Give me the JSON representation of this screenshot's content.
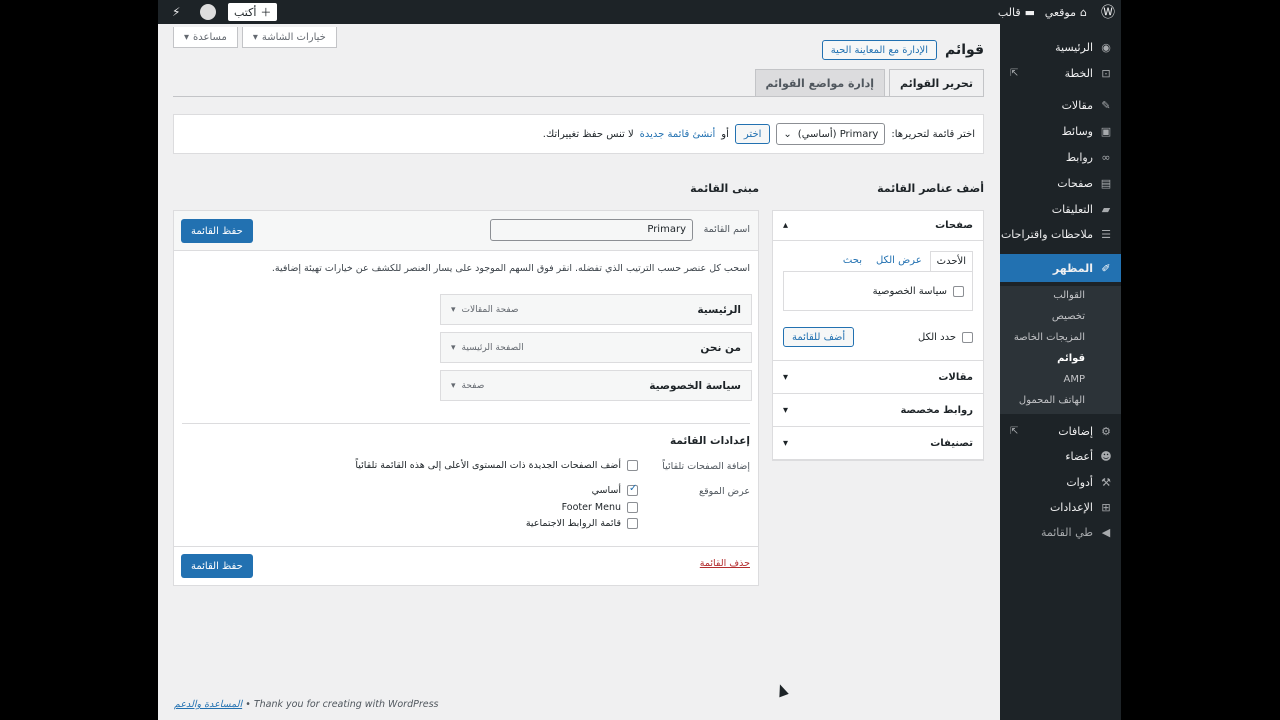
{
  "adminbar": {
    "site_name": "موقعي",
    "theme_label": "قالب",
    "new_label": "أكتب"
  },
  "sidebar": {
    "items": [
      {
        "label": "الرئيسية",
        "icon": "dashboard-icon"
      },
      {
        "label": "الخطة",
        "icon": "cart-icon"
      },
      {
        "label": "مقالات",
        "icon": "pin-icon"
      },
      {
        "label": "وسائط",
        "icon": "media-icon"
      },
      {
        "label": "روابط",
        "icon": "link-icon"
      },
      {
        "label": "صفحات",
        "icon": "page-icon"
      },
      {
        "label": "التعليقات",
        "icon": "comment-icon"
      },
      {
        "label": "ملاحظات واقتراحات",
        "icon": "feedback-icon"
      },
      {
        "label": "المظهر",
        "icon": "brush-icon"
      },
      {
        "label": "إضافات",
        "icon": "plugin-icon"
      },
      {
        "label": "أعضاء",
        "icon": "user-icon"
      },
      {
        "label": "أدوات",
        "icon": "wrench-icon"
      },
      {
        "label": "الإعدادات",
        "icon": "settings-icon"
      },
      {
        "label": "طي القائمة",
        "icon": "collapse-icon"
      }
    ],
    "submenu": [
      "القوالب",
      "تخصيص",
      "المزيجات الخاصة",
      "قوائم",
      "AMP",
      "الهاتف المحمول"
    ]
  },
  "screen_tabs": {
    "options": "خيارات الشاشة",
    "help": "مساعدة"
  },
  "header": {
    "title": "قوائم",
    "preview_button": "الإدارة مع المعاينة الحية"
  },
  "tabs": {
    "edit": "تحرير القوائم",
    "locations": "إدارة مواضع القوائم"
  },
  "select_menu": {
    "label": "اختر قائمة لتحريرها:",
    "selected": "Primary (أساسي)",
    "select_button": "اختر",
    "or_text": "أو",
    "create_link": "أنشئ قائمة جديدة",
    "save_reminder": "لا تنس حفظ تغييراتك."
  },
  "add_items": {
    "title": "أضف عناصر القائمة",
    "pages_title": "صفحات",
    "tab_recent": "الأحدث",
    "tab_all": "عرض الكل",
    "tab_search": "بحث",
    "page_item": "سياسة الخصوصية",
    "select_all": "حدد الكل",
    "add_button": "أضف للقائمة",
    "posts": "مقالات",
    "custom_links": "روابط مخصصة",
    "categories": "تصنيفات"
  },
  "structure": {
    "title": "مبنى القائمة",
    "name_label": "اسم القائمة",
    "name_value": "Primary",
    "save_button": "حفظ القائمة",
    "instructions": "اسحب كل عنصر حسب الترتيب الذي تفضله. انقر فوق السهم الموجود على يسار العنصر للكشف عن خيارات تهيئة إضافية.",
    "items": [
      {
        "title": "الرئيسية",
        "type": "صفحة المقالات"
      },
      {
        "title": "من نحن",
        "type": "الصفحة الرئيسية"
      },
      {
        "title": "سياسة الخصوصية",
        "type": "صفحة"
      }
    ],
    "settings_title": "إعدادات القائمة",
    "auto_add_label": "إضافة الصفحات تلقائياً",
    "auto_add_text": "أضف الصفحات الجديدة ذات المستوى الأعلى إلى هذه القائمة تلقائياً",
    "display_location": "عرض الموقع",
    "locations": [
      {
        "label": "أساسي",
        "checked": true
      },
      {
        "label": "Footer Menu",
        "checked": false
      },
      {
        "label": "قائمة الروابط الاجتماعية",
        "checked": false
      }
    ],
    "delete_link": "حذف القائمة"
  },
  "footer": {
    "thanks": "Thank you for creating with WordPress",
    "help": "المساعدة والدعم",
    "separator": "•"
  },
  "colors": {
    "accent": "#2271b1",
    "admin_dark": "#1d2327"
  }
}
